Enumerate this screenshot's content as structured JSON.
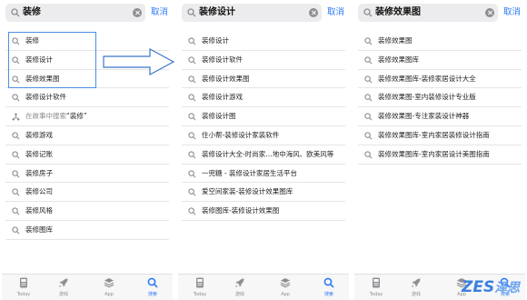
{
  "accent_color": "#2f7cf6",
  "highlight_color": "#4a90e2",
  "panels": [
    {
      "query": "装修",
      "cancel_label": "取消",
      "rows": [
        {
          "label": "装修",
          "icon": "search-icon"
        },
        {
          "label": "装修设计",
          "icon": "search-icon"
        },
        {
          "label": "装修效果图",
          "icon": "search-icon"
        },
        {
          "label": "装修设计软件",
          "icon": "search-icon"
        },
        {
          "label_prefix": "在故事中搜索",
          "label_quote": "“装修”",
          "icon": "stories-icon",
          "muted": true
        },
        {
          "label": "装修游戏",
          "icon": "search-icon"
        },
        {
          "label": "装修记账",
          "icon": "search-icon"
        },
        {
          "label": "装修房子",
          "icon": "search-icon"
        },
        {
          "label": "装修公司",
          "icon": "search-icon"
        },
        {
          "label": "装修风格",
          "icon": "search-icon"
        },
        {
          "label": "装修图库",
          "icon": "search-icon"
        }
      ]
    },
    {
      "query": "装修设计",
      "cancel_label": "取消",
      "rows": [
        {
          "label": "装修设计",
          "icon": "search-icon"
        },
        {
          "label": "装修设计软件",
          "icon": "search-icon"
        },
        {
          "label": "装修设计效果图",
          "icon": "search-icon"
        },
        {
          "label": "装修设计游戏",
          "icon": "search-icon"
        },
        {
          "label": "装修设计图",
          "icon": "search-icon"
        },
        {
          "label": "住小帮-装修设计家装软件",
          "icon": "search-icon"
        },
        {
          "label": "装修设计大全-时尚家…地中海风、欧美风等",
          "icon": "search-icon"
        },
        {
          "label": "一兜糖 - 装修设计家居生活平台",
          "icon": "search-icon"
        },
        {
          "label": "爱空间家装-装修设计效果图库",
          "icon": "search-icon"
        },
        {
          "label": "装修图库-装修设计效果图",
          "icon": "search-icon"
        }
      ]
    },
    {
      "query": "装修效果图",
      "cancel_label": "取消",
      "rows": [
        {
          "label": "装修效果图",
          "icon": "search-icon"
        },
        {
          "label": "装修效果图库",
          "icon": "search-icon"
        },
        {
          "label": "装修效果图库-装修家居设计大全",
          "icon": "search-icon"
        },
        {
          "label": "装修效果图-室内装修设计专业版",
          "icon": "search-icon"
        },
        {
          "label": "装修效果图-专注家装设计神器",
          "icon": "search-icon"
        },
        {
          "label": "装修效果图库-室内家居装修设计指南",
          "icon": "search-icon"
        },
        {
          "label": "装修效果图库-室内家居设计美图指南",
          "icon": "search-icon"
        }
      ]
    }
  ],
  "tabbar": {
    "tabs": [
      {
        "label": "Today",
        "icon": "today-icon"
      },
      {
        "label": "游戏",
        "icon": "rocket-icon"
      },
      {
        "label": "App",
        "icon": "app-stack-icon"
      },
      {
        "label": "搜索",
        "icon": "search-icon",
        "active": true
      }
    ]
  },
  "watermark": {
    "latin": "ZES",
    "chinese": "泽思"
  }
}
